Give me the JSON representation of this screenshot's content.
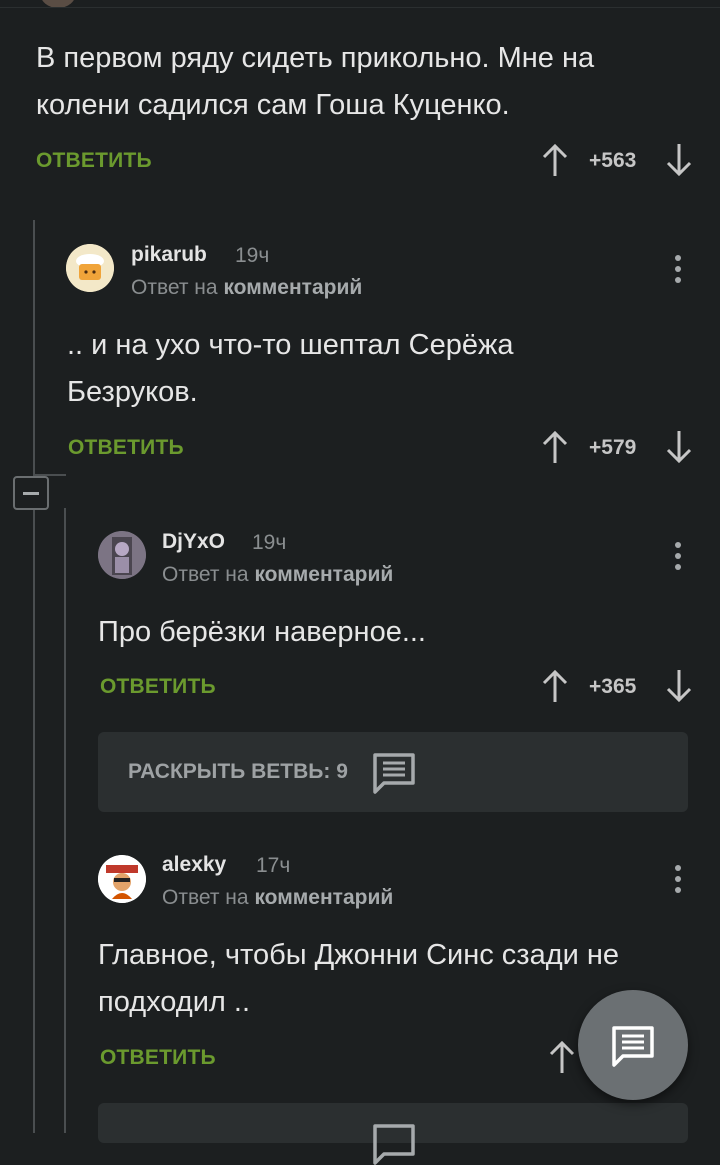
{
  "comments": [
    {
      "text_lines": [
        "В первом ряду сидеть прикольно. Мне на",
        "колени садился сам Гоша Куценко."
      ],
      "reply_label": "ОТВЕТИТЬ",
      "score": "+563"
    },
    {
      "author": "pikarub",
      "time": "19ч",
      "reply_to_prefix": "Ответ на",
      "reply_to_target": "комментарий",
      "text_lines": [
        ".. и на ухо что-то шептал Серёжа",
        "Безруков."
      ],
      "reply_label": "ОТВЕТИТЬ",
      "score": "+579"
    },
    {
      "author": "DjYxO",
      "time": "19ч",
      "reply_to_prefix": "Ответ на",
      "reply_to_target": "комментарий",
      "text_lines": [
        "Про берёзки наверное..."
      ],
      "reply_label": "ОТВЕТИТЬ",
      "score": "+365"
    },
    {
      "author": "alexky",
      "time": "17ч",
      "reply_to_prefix": "Ответ на",
      "reply_to_target": "комментарий",
      "text_lines": [
        "Главное, чтобы Джонни Синс сзади не",
        "подходил .."
      ],
      "reply_label": "ОТВЕТИТЬ"
    }
  ],
  "branch": {
    "label": "РАСКРЫТЬ ВЕТВЬ: 9"
  },
  "icons": {
    "upvote": "arrow-up-icon",
    "downvote": "arrow-down-icon",
    "more": "more-vertical-icon",
    "branch": "comment-icon",
    "collapse": "minus-icon",
    "fab": "comment-icon"
  },
  "colors": {
    "background": "#1c1f20",
    "reply_green": "#6b9a2e",
    "panel": "#2b2f30",
    "fab": "#6b7073"
  }
}
